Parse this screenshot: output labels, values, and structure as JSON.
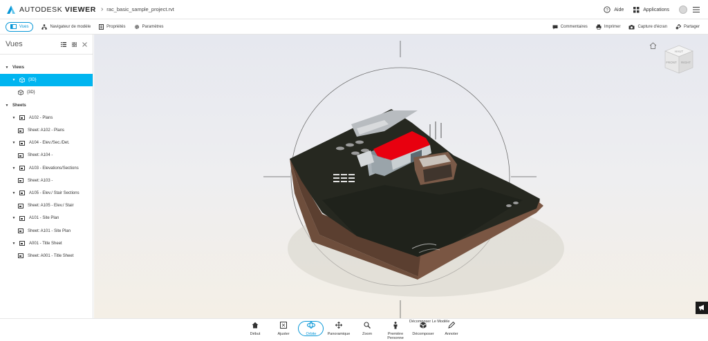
{
  "header": {
    "brand_light": "AUTODESK",
    "brand_bold": "VIEWER",
    "filename": "rac_basic_sample_project.rvt",
    "help_label": "Aide",
    "apps_label": "Applications"
  },
  "toolbar": {
    "left": [
      {
        "label": "Vues",
        "icon": "views-icon",
        "active": true
      },
      {
        "label": "Navigateur de modèle",
        "icon": "model-browser-icon"
      },
      {
        "label": "Propriétés",
        "icon": "properties-icon"
      },
      {
        "label": "Paramètres",
        "icon": "settings-icon"
      }
    ],
    "right": [
      {
        "label": "Commentaires",
        "icon": "comment-icon"
      },
      {
        "label": "Imprimer",
        "icon": "print-icon"
      },
      {
        "label": "Capture d'écran",
        "icon": "camera-icon"
      },
      {
        "label": "Partager",
        "icon": "share-icon"
      }
    ]
  },
  "panel": {
    "title": "Vues",
    "tree": [
      {
        "label": "Views",
        "level": 0,
        "type": "group",
        "expanded": true
      },
      {
        "label": "{3D}",
        "level": 1,
        "type": "3d",
        "expanded": true,
        "selected": true
      },
      {
        "label": "{3D}",
        "level": 2,
        "type": "3d"
      },
      {
        "label": "Sheets",
        "level": 0,
        "type": "group",
        "expanded": true
      },
      {
        "label": "A102 - Plans",
        "level": 1,
        "type": "sheet",
        "expanded": true
      },
      {
        "label": "Sheet: A102 - Plans",
        "level": 2,
        "type": "sheet"
      },
      {
        "label": "A104 - Elev./Sec./Det.",
        "level": 1,
        "type": "sheet",
        "expanded": true
      },
      {
        "label": "Sheet: A104 -",
        "level": 2,
        "type": "sheet"
      },
      {
        "label": "A103 - Elevations/Sections",
        "level": 1,
        "type": "sheet",
        "expanded": true
      },
      {
        "label": "Sheet: A103 -",
        "level": 2,
        "type": "sheet"
      },
      {
        "label": "A105 - Elev./ Stair Sections",
        "level": 1,
        "type": "sheet",
        "expanded": true
      },
      {
        "label": "Sheet: A105 - Elev./ Stair",
        "level": 2,
        "type": "sheet"
      },
      {
        "label": "A101 - Site Plan",
        "level": 1,
        "type": "sheet",
        "expanded": true
      },
      {
        "label": "Sheet: A101 - Site Plan",
        "level": 2,
        "type": "sheet"
      },
      {
        "label": "A001 - Title Sheet",
        "level": 1,
        "type": "sheet",
        "expanded": true
      },
      {
        "label": "Sheet: A001 - Title Sheet",
        "level": 2,
        "type": "sheet"
      }
    ]
  },
  "viewcube": {
    "front": "FRONT",
    "right": "RIGHT",
    "top": "HAUT"
  },
  "bottom": {
    "tools": [
      {
        "label": "Début",
        "icon": "home-icon"
      },
      {
        "label": "Ajuster",
        "icon": "fit-icon"
      },
      {
        "label": "Orbite",
        "icon": "orbit-icon",
        "active": true
      },
      {
        "label": "Panoramique",
        "icon": "pan-icon"
      },
      {
        "label": "Zoom",
        "icon": "zoom-icon"
      },
      {
        "label": "Première Personne",
        "icon": "first-person-icon"
      },
      {
        "label": "Décomposer",
        "icon": "explode-icon"
      },
      {
        "label": "Annoter",
        "icon": "annotate-icon"
      }
    ],
    "tooltip": "Décomposer Le Modèle"
  },
  "colors": {
    "accent": "#0696d7",
    "selection": "#00b5f0",
    "roof": "#e8000f"
  }
}
